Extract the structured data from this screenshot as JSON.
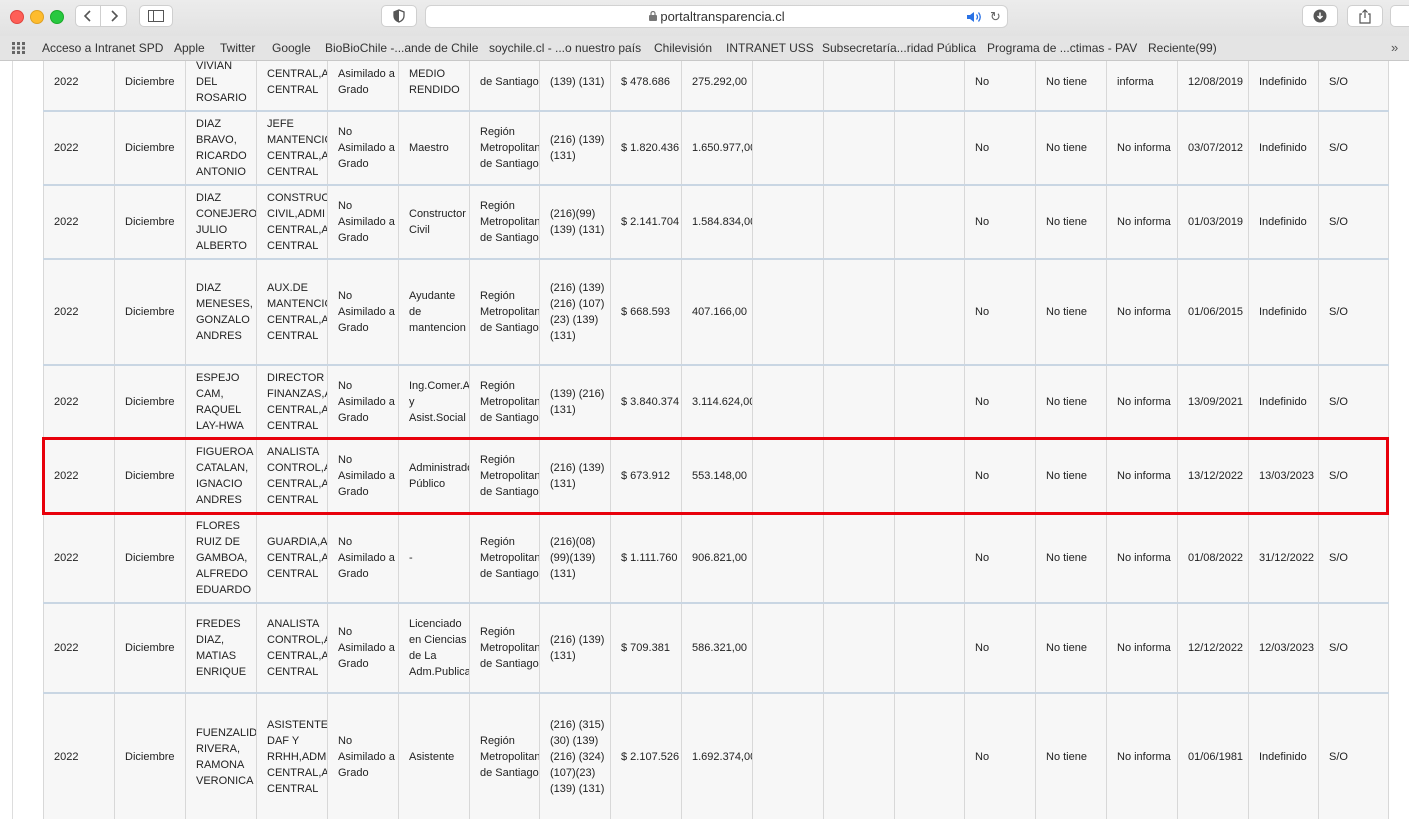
{
  "browser": {
    "url": "portaltransparencia.cl",
    "bookmarks": [
      "Acceso a Intranet SPD",
      "Apple",
      "Twitter",
      "Google",
      "BioBioChile -...ande de Chile",
      "soychile.cl - ...o nuestro país",
      "Chilevisión",
      "INTRANET USS",
      "Subsecretaría...ridad Pública",
      "Programa de ...ctimas - PAV",
      "Reciente(99)"
    ],
    "icons": [
      "back-icon",
      "forward-icon",
      "sidebar-icon",
      "shield-icon",
      "lock-icon",
      "audio-icon",
      "reload-icon",
      "download-icon",
      "share-icon",
      "apps-grid-icon",
      "more-icon"
    ]
  },
  "colors": {
    "highlight": "#e8000b",
    "row_separator": "#c9d6e3"
  },
  "table": {
    "rows": [
      {
        "year": "2022",
        "month": "Diciembre",
        "name": "VIVIAN DEL ROSARIO",
        "position": "CENTRAL,A CENTRAL",
        "grade": "Asimilado a Grado",
        "title": "MEDIO RENDIDO",
        "region": "de Santiago",
        "assign": "(139) (131)",
        "gross": "$ 478.686",
        "net": "275.292,00",
        "flag1": "No",
        "flag2": "No tiene",
        "flag3": "informa",
        "start": "12/08/2019",
        "end": "Indefinido",
        "obs": "S/O"
      },
      {
        "year": "2022",
        "month": "Diciembre",
        "name": "DIAZ BRAVO, RICARDO ANTONIO",
        "position": "JEFE MANTENCIO CENTRAL,A CENTRAL",
        "grade": "No Asimilado a Grado",
        "title": "Maestro",
        "region": "Región Metropolitan de Santiago",
        "assign": "(216) (139) (131)",
        "gross": "$ 1.820.436",
        "net": "1.650.977,00",
        "flag1": "No",
        "flag2": "No tiene",
        "flag3": "No informa",
        "start": "03/07/2012",
        "end": "Indefinido",
        "obs": "S/O"
      },
      {
        "year": "2022",
        "month": "Diciembre",
        "name": "DIAZ CONEJERO JULIO ALBERTO",
        "position": "CONSTRUC CIVIL,ADMI CENTRAL,A CENTRAL",
        "grade": "No Asimilado a Grado",
        "title": "Constructor Civil",
        "region": "Región Metropolitan de Santiago",
        "assign": "(216)(99) (139) (131)",
        "gross": "$ 2.141.704",
        "net": "1.584.834,00",
        "flag1": "No",
        "flag2": "No tiene",
        "flag3": "No informa",
        "start": "01/03/2019",
        "end": "Indefinido",
        "obs": "S/O"
      },
      {
        "year": "2022",
        "month": "Diciembre",
        "name": "DIAZ MENESES, GONZALO ANDRES",
        "position": "AUX.DE MANTENCIO CENTRAL,A CENTRAL",
        "grade": "No Asimilado a Grado",
        "title": "Ayudante de mantencion",
        "region": "Región Metropolitan de Santiago",
        "assign": "(216) (139) (216) (107)(23) (139) (131)",
        "gross": "$ 668.593",
        "net": "407.166,00",
        "flag1": "No",
        "flag2": "No tiene",
        "flag3": "No informa",
        "start": "01/06/2015",
        "end": "Indefinido",
        "obs": "S/O"
      },
      {
        "year": "2022",
        "month": "Diciembre",
        "name": "ESPEJO CAM, RAQUEL LAY-HWA",
        "position": "DIRECTOR FINANZAS,A CENTRAL,A CENTRAL",
        "grade": "No Asimilado a Grado",
        "title": "Ing.Comer.A y Asist.Social",
        "region": "Región Metropolitan de Santiago",
        "assign": "(139) (216) (131)",
        "gross": "$ 3.840.374",
        "net": "3.114.624,00",
        "flag1": "No",
        "flag2": "No tiene",
        "flag3": "No informa",
        "start": "13/09/2021",
        "end": "Indefinido",
        "obs": "S/O"
      },
      {
        "year": "2022",
        "month": "Diciembre",
        "name": "FIGUEROA CATALAN, IGNACIO ANDRES",
        "position": "ANALISTA CONTROL,A CENTRAL,A CENTRAL",
        "grade": "No Asimilado a Grado",
        "title": "Administrado Público",
        "region": "Región Metropolitan de Santiago",
        "assign": "(216) (139) (131)",
        "gross": "$ 673.912",
        "net": "553.148,00",
        "flag1": "No",
        "flag2": "No tiene",
        "flag3": "No informa",
        "start": "13/12/2022",
        "end": "13/03/2023",
        "obs": "S/O"
      },
      {
        "year": "2022",
        "month": "Diciembre",
        "name": "FLORES RUIZ DE GAMBOA, ALFREDO EDUARDO",
        "position": "GUARDIA,A CENTRAL,A CENTRAL",
        "grade": "No Asimilado a Grado",
        "title": "-",
        "region": "Región Metropolitan de Santiago",
        "assign": "(216)(08) (99)(139) (131)",
        "gross": "$ 1.111.760",
        "net": "906.821,00",
        "flag1": "No",
        "flag2": "No tiene",
        "flag3": "No informa",
        "start": "01/08/2022",
        "end": "31/12/2022",
        "obs": "S/O"
      },
      {
        "year": "2022",
        "month": "Diciembre",
        "name": "FREDES DIAZ, MATIAS ENRIQUE",
        "position": "ANALISTA CONTROL,A CENTRAL,A CENTRAL",
        "grade": "No Asimilado a Grado",
        "title": "Licenciado en Ciencias de La Adm.Publica",
        "region": "Región Metropolitan de Santiago",
        "assign": "(216) (139) (131)",
        "gross": "$ 709.381",
        "net": "586.321,00",
        "flag1": "No",
        "flag2": "No tiene",
        "flag3": "No informa",
        "start": "12/12/2022",
        "end": "12/03/2023",
        "obs": "S/O"
      },
      {
        "year": "2022",
        "month": "Diciembre",
        "name": "FUENZALID RIVERA, RAMONA VERONICA",
        "position": "ASISTENTE DAF Y RRHH,ADM CENTRAL,A CENTRAL",
        "grade": "No Asimilado a Grado",
        "title": "Asistente",
        "region": "Región Metropolitan de Santiago",
        "assign": "(216) (315)(30) (139) (216) (324) (107)(23) (139) (131)",
        "gross": "$ 2.107.526",
        "net": "1.692.374,00",
        "flag1": "No",
        "flag2": "No tiene",
        "flag3": "No informa",
        "start": "01/06/1981",
        "end": "Indefinido",
        "obs": "S/O"
      }
    ]
  }
}
